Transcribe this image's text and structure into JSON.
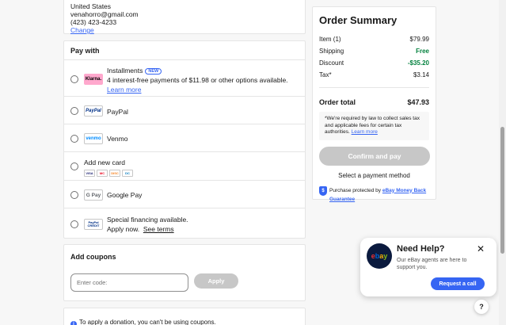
{
  "address": {
    "country": "United States",
    "email": "venahorro@gmail.com",
    "phone": "(423) 423-4233",
    "change_link": "Change"
  },
  "pay_with": {
    "title": "Pay with",
    "options": [
      {
        "name": "Installments",
        "badge": "NEW",
        "logo": "Klarna.",
        "desc": "4 interest-free payments of $11.98 or other options available.",
        "link": "Learn more"
      },
      {
        "name": "PayPal",
        "logo": "PayPal"
      },
      {
        "name": "Venmo",
        "logo": "venmo"
      },
      {
        "name": "Add new card",
        "card_logos": [
          "VISA",
          "MC",
          "DISC",
          "DC"
        ]
      },
      {
        "name": "Google Pay",
        "logo": "G Pay"
      },
      {
        "name": "Special financing available.",
        "logo": "PayPal CREDIT",
        "line2": "Apply now.",
        "link": "See terms"
      }
    ]
  },
  "coupons": {
    "title": "Add coupons",
    "placeholder": "Enter code:",
    "apply_label": "Apply"
  },
  "donation": {
    "info_icon": "i",
    "text": "To apply a donation, you can't be using coupons."
  },
  "summary": {
    "title": "Order Summary",
    "rows": [
      {
        "label": "Item (1)",
        "value": "$79.99"
      },
      {
        "label": "Shipping",
        "value": "Free"
      },
      {
        "label": "Discount",
        "value": "-$35.20"
      },
      {
        "label": "Tax*",
        "value": "$3.14"
      }
    ],
    "total_label": "Order total",
    "total_value": "$47.93",
    "tax_note": "*We're required by law to collect sales tax and applicable fees for certain tax authorities.",
    "tax_note_link": "Learn more",
    "confirm_label": "Confirm and pay",
    "select_msg": "Select a payment method",
    "protect_text": "Purchase protected by",
    "protect_link": "eBay Money Back Guarantee",
    "shield_glyph": "$"
  },
  "help": {
    "logo": "ebay",
    "title": "Need Help?",
    "body": "Our eBay agents are here to support you.",
    "close": "✕",
    "request_label": "Request a call",
    "fab_label": "?"
  },
  "colors": {
    "accent": "#3665f3",
    "green": "#05823f",
    "disabled": "#c7c7c7"
  }
}
